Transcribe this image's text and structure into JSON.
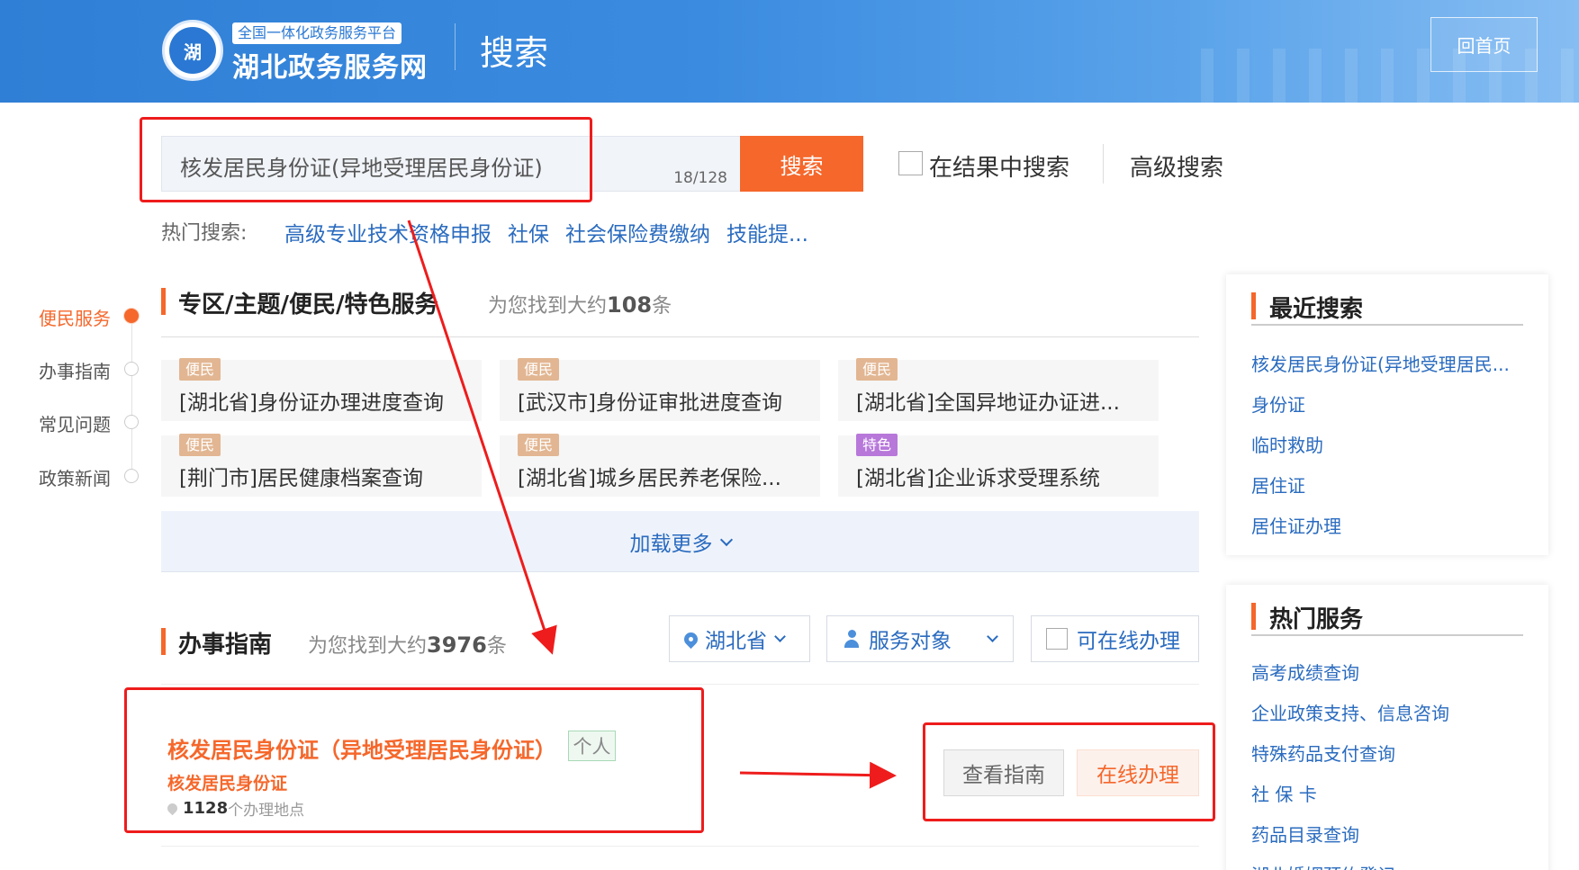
{
  "header": {
    "logo_label": "湖",
    "platform_badge": "全国一体化政务服务平台",
    "site_name": "湖北政务服务网",
    "page_title": "搜索",
    "home_button": "回首页",
    "gradient_colors": [
      "#2f7fd6",
      "#86bdf2"
    ]
  },
  "search": {
    "value": "核发居民身份证(异地受理居民身份证)",
    "char_count": "18/128",
    "button": "搜索",
    "in_results_label": "在结果中搜索",
    "in_results_checked": false,
    "advanced_label": "高级搜索",
    "hot_label": "热门搜索:",
    "hot_items": [
      "高级专业技术资格申报",
      "社保",
      "社会保险费缴纳",
      "技能提..."
    ]
  },
  "left_nav": {
    "items": [
      {
        "label": "便民服务",
        "active": true
      },
      {
        "label": "办事指南",
        "active": false
      },
      {
        "label": "常见问题",
        "active": false
      },
      {
        "label": "政策新闻",
        "active": false
      }
    ]
  },
  "section_services": {
    "title": "专区/主题/便民/特色服务",
    "found_prefix": "为您找到大约",
    "found_count": "108",
    "found_suffix": "条",
    "cards": [
      {
        "tag": "便民",
        "title": "[湖北省]身份证办理进度查询"
      },
      {
        "tag": "便民",
        "title": "[武汉市]身份证审批进度查询"
      },
      {
        "tag": "便民",
        "title": "[湖北省]全国异地证办证进..."
      },
      {
        "tag": "便民",
        "title": "[荆门市]居民健康档案查询"
      },
      {
        "tag": "便民",
        "title": "[湖北省]城乡居民养老保险..."
      },
      {
        "tag": "特色",
        "title": "[湖北省]企业诉求受理系统"
      }
    ],
    "load_more": "加载更多"
  },
  "section_guide": {
    "title": "办事指南",
    "found_prefix": "为您找到大约",
    "found_count": "3976",
    "found_suffix": "条",
    "filters": {
      "region": "湖北省",
      "audience": "服务对象",
      "online_only": "可在线办理"
    },
    "result": {
      "title": "核发居民身份证（异地受理居民身份证）",
      "tag": "个人",
      "subtitle": "核发居民身份证",
      "location_count": "1128",
      "location_suffix": "个办理地点",
      "guide_button": "查看指南",
      "online_button": "在线办理"
    }
  },
  "recent_search": {
    "title": "最近搜索",
    "items": [
      "核发居民身份证(异地受理居民...",
      "身份证",
      "临时救助",
      "居住证",
      "居住证办理"
    ]
  },
  "hot_services": {
    "title": "热门服务",
    "items": [
      "高考成绩查询",
      "企业政策支持、信息咨询",
      "特殊药品支付查询",
      "社 保 卡",
      "药品目录查询",
      "湖北婚姻预约登记"
    ]
  },
  "colors": {
    "accent": "#f5672b",
    "link": "#2a6bbf",
    "annotation_red": "#ee1c1c"
  }
}
